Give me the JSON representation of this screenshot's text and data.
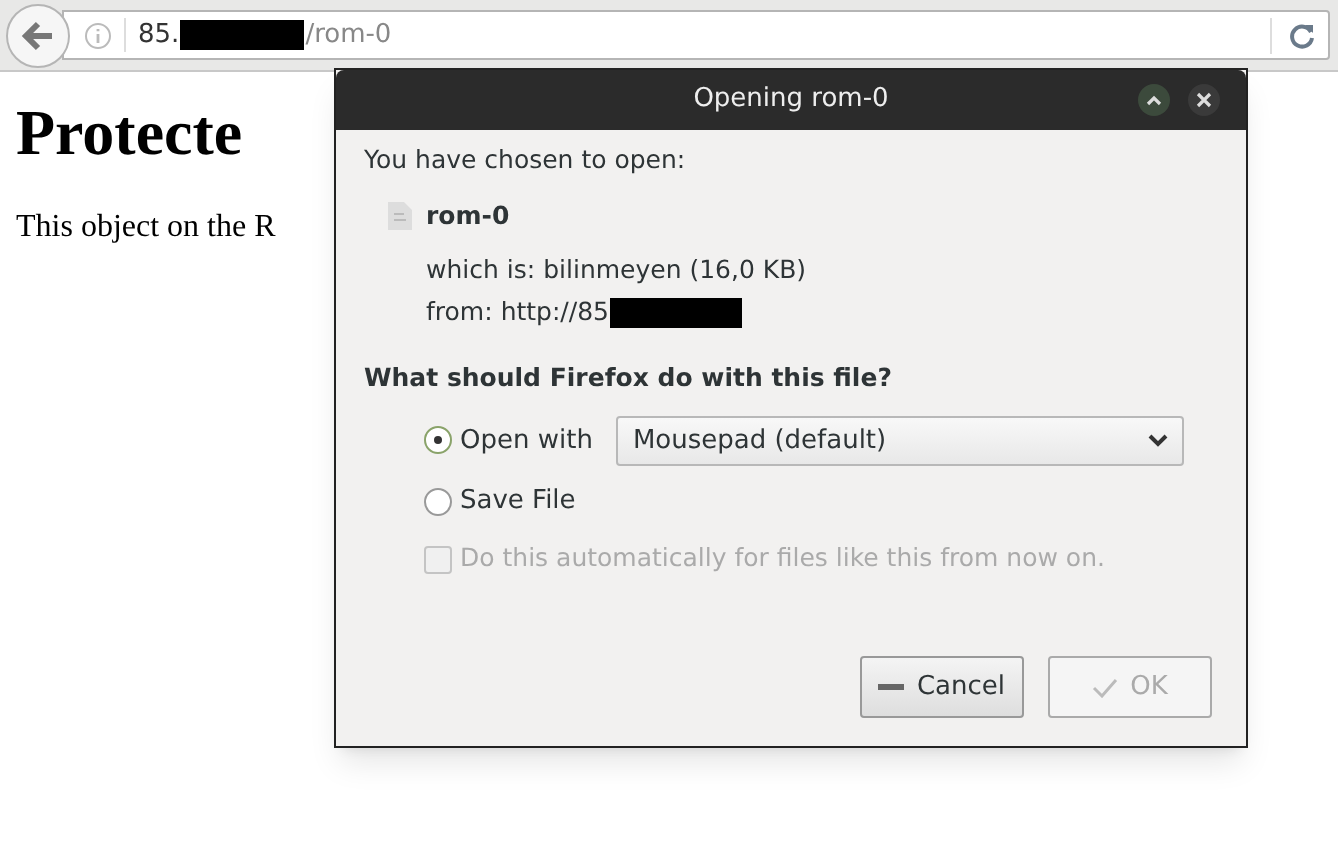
{
  "browser": {
    "url_prefix": "85.",
    "url_suffix": "/rom-0"
  },
  "page": {
    "heading": "Protecte",
    "text": "This object on the R"
  },
  "dialog": {
    "title": "Opening rom-0",
    "intro": "You have chosen to open:",
    "file_name": "rom-0",
    "type_label": "which is:",
    "type_value": "bilinmeyen (16,0 KB)",
    "from_label": "from:",
    "from_value": "http://85",
    "question": "What should Firefox do with this file?",
    "options": [
      {
        "kind": "open",
        "label": "Open with",
        "selected": true,
        "app": "Mousepad (default)"
      },
      {
        "kind": "save",
        "label": "Save File",
        "selected": false
      }
    ],
    "auto": {
      "label": "Do this automatically for files like this from now on.",
      "checked": false,
      "disabled": true
    },
    "buttons": [
      {
        "kind": "cancel",
        "label": "Cancel",
        "disabled": false
      },
      {
        "kind": "ok",
        "label": "OK",
        "disabled": true
      }
    ]
  }
}
